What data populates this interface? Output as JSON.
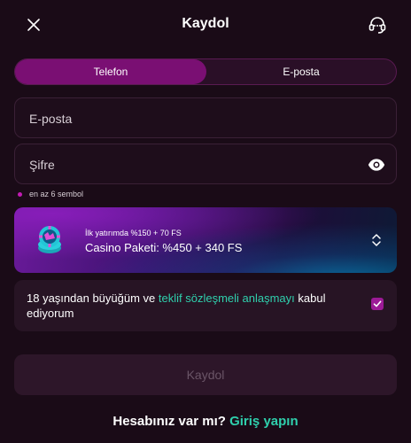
{
  "header": {
    "title": "Kaydol"
  },
  "tabs": [
    {
      "label": "Telefon",
      "active": true
    },
    {
      "label": "E-posta",
      "active": false
    }
  ],
  "form": {
    "email_placeholder": "E-posta",
    "password_placeholder": "Şifre",
    "password_hint": "en az 6 sembol"
  },
  "promo": {
    "subtitle": "İlk yatırımda %150 + 70 FS",
    "title": "Casino Paketi: %450 + 340 FS"
  },
  "agreement": {
    "text_before": "18 yaşından büyüğüm ve ",
    "link": "teklif sözleşmeli anlaşmayı",
    "text_after": " kabul ediyorum",
    "checked": true
  },
  "submit_label": "Kaydol",
  "footer": {
    "question": "Hesabınız var mı?",
    "link": "Giriş yapın"
  },
  "colors": {
    "accent": "#9c1a96",
    "link": "#2fd0ad",
    "background": "#1a0b17"
  },
  "icons": {
    "close": "close-icon",
    "support": "headset-icon",
    "eye": "eye-icon",
    "promo": "casino-chip-icon",
    "chevron": "chevron-updown-icon",
    "check": "checkmark-icon"
  }
}
